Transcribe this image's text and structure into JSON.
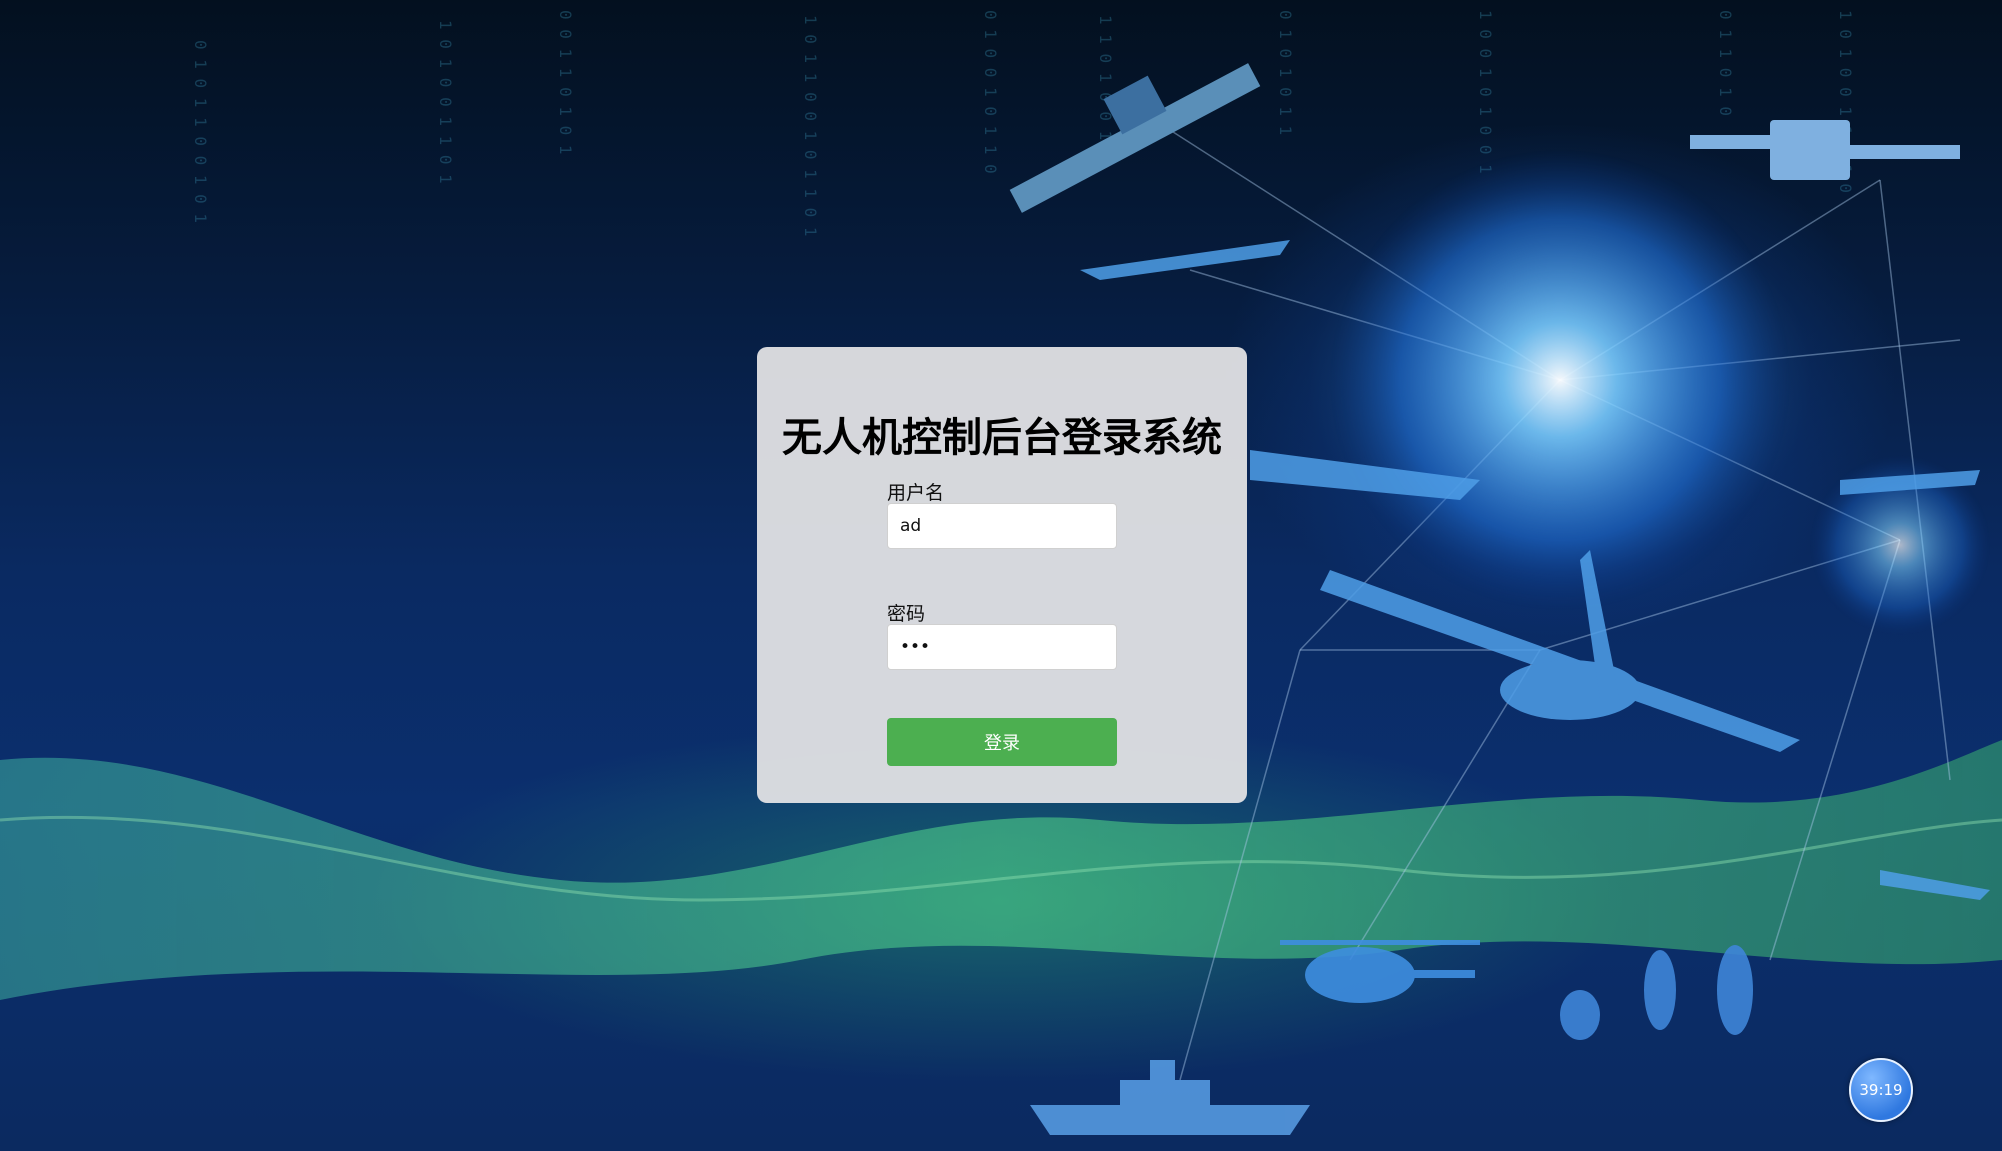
{
  "login": {
    "title": "无人机控制后台登录系统",
    "username_label": "用户名",
    "username_value": "ad",
    "password_label": "密码",
    "password_value": "•••",
    "submit_label": "登录"
  },
  "timer": {
    "value": "39:19"
  },
  "colors": {
    "button_green": "#4caf50",
    "card_bg": "#e1e2e4",
    "timer_blue": "#2f78e0"
  }
}
